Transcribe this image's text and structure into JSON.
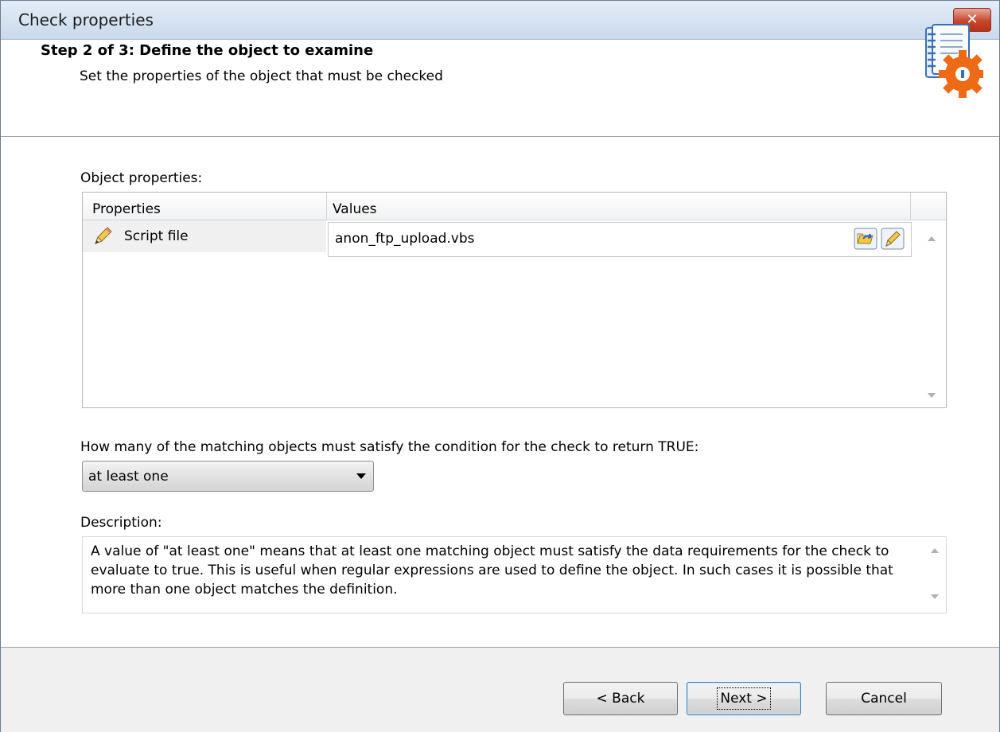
{
  "window": {
    "title": "Check properties",
    "close_glyph": "✕"
  },
  "header": {
    "step_title": "Step 2 of 3: Define the object to examine",
    "step_subtitle": "Set the properties of the object that must be checked",
    "icon": "checklist-gear-icon"
  },
  "object_properties": {
    "label": "Object properties:",
    "columns": [
      "Properties",
      "Values"
    ],
    "rows": [
      {
        "property": "Script file",
        "value": "anon_ftp_upload.vbs"
      }
    ]
  },
  "condition": {
    "label": "How many of the matching objects must satisfy the condition for the check to return TRUE:",
    "selected": "at least one"
  },
  "description": {
    "label": "Description:",
    "text": "A value of \"at least one\" means that at least one matching object must satisfy the data requirements for the check to evaluate to true. This is useful when regular expressions are used to define the object. In such cases it is possible that more than one object matches the definition."
  },
  "buttons": {
    "back": "< Back",
    "next": "Next >",
    "cancel": "Cancel"
  },
  "colors": {
    "titlebar": "#c9d9ec",
    "close_button": "#c8462e",
    "footer": "#f0f0f0"
  }
}
